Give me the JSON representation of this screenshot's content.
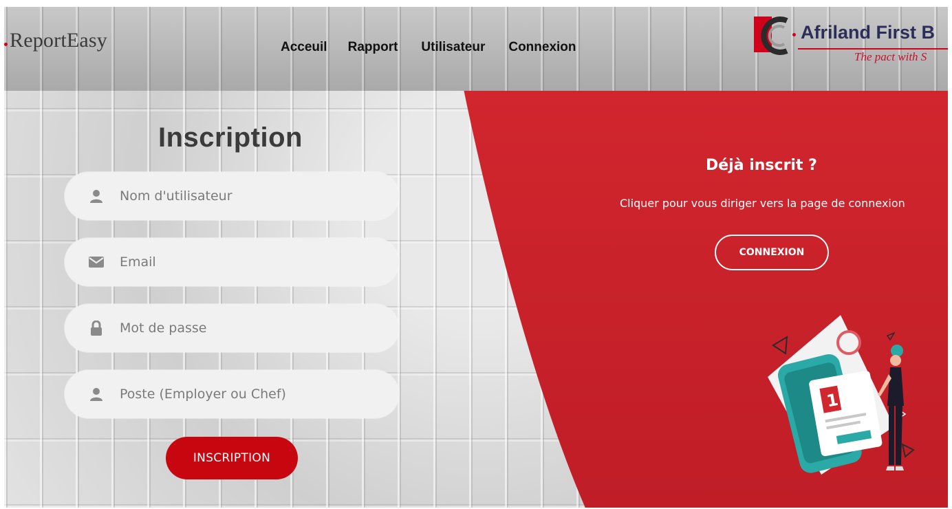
{
  "header": {
    "brand": "ReportEasy",
    "nav": [
      "Acceuil",
      "Rapport",
      "Utilisateur",
      "Connexion"
    ],
    "bank_logo_text": "Afriland First B",
    "bank_logo_tagline": "The pact with S"
  },
  "form": {
    "title": "Inscription",
    "fields": [
      {
        "icon": "user-icon",
        "placeholder": "Nom d'utilisateur",
        "value": ""
      },
      {
        "icon": "envelope-icon",
        "placeholder": "Email",
        "value": ""
      },
      {
        "icon": "lock-icon",
        "placeholder": "Mot de passe",
        "value": ""
      },
      {
        "icon": "user-icon",
        "placeholder": "Poste (Employer ou Chef)",
        "value": ""
      }
    ],
    "submit_label": "INSCRIPTION"
  },
  "side_panel": {
    "title": "Déjà inscrit ?",
    "subtitle": "Cliquer pour vous diriger vers la page de connexion",
    "button_label": "CONNEXION"
  },
  "illustration_card_text": "1",
  "colors": {
    "accent": "#c8060f",
    "panel_red": "#c9252f",
    "field_bg": "#f1f1f1"
  }
}
